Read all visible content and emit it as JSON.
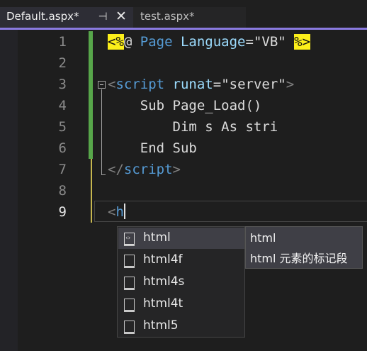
{
  "tabs": [
    {
      "title": "Default.aspx*",
      "active": true
    },
    {
      "title": "test.aspx*",
      "active": false
    }
  ],
  "tab_icons": {
    "pin": "pin-icon",
    "close": "close-icon"
  },
  "editor": {
    "lines": [
      {
        "number": "1",
        "tokens": [
          {
            "t": "<%",
            "c": "hl-yellow"
          },
          {
            "t": "@ ",
            "c": "c-text"
          },
          {
            "t": "Page ",
            "c": "c-blue"
          },
          {
            "t": "Language",
            "c": "c-attr"
          },
          {
            "t": "=",
            "c": "c-text"
          },
          {
            "t": "\"VB\"",
            "c": "c-text"
          },
          {
            "t": " ",
            "c": "c-text"
          },
          {
            "t": "%>",
            "c": "hl-yellow"
          }
        ]
      },
      {
        "number": "2",
        "tokens": []
      },
      {
        "number": "3",
        "tokens": [
          {
            "t": "<",
            "c": "c-punct"
          },
          {
            "t": "script",
            "c": "c-tag"
          },
          {
            "t": " ",
            "c": "c-text"
          },
          {
            "t": "runat",
            "c": "c-attr"
          },
          {
            "t": "=",
            "c": "c-text"
          },
          {
            "t": "\"server\"",
            "c": "c-text"
          },
          {
            "t": ">",
            "c": "c-punct"
          }
        ]
      },
      {
        "number": "4",
        "tokens": [
          {
            "t": "    Sub Page_Load()",
            "c": "c-text"
          }
        ]
      },
      {
        "number": "5",
        "tokens": [
          {
            "t": "        Dim s As stri",
            "c": "c-text"
          }
        ]
      },
      {
        "number": "6",
        "tokens": [
          {
            "t": "    End Sub",
            "c": "c-text"
          }
        ]
      },
      {
        "number": "7",
        "tokens": [
          {
            "t": "</",
            "c": "c-punct"
          },
          {
            "t": "script",
            "c": "c-tag"
          },
          {
            "t": ">",
            "c": "c-punct"
          }
        ]
      },
      {
        "number": "8",
        "tokens": []
      },
      {
        "number": "9",
        "tokens": [
          {
            "t": "<",
            "c": "c-punct"
          },
          {
            "t": "h",
            "c": "c-tag"
          }
        ]
      }
    ],
    "current_line": "9"
  },
  "completion": {
    "items": [
      "html",
      "html4f",
      "html4s",
      "html4t",
      "html5"
    ],
    "selected_index": 0,
    "tooltip": {
      "title": "html",
      "description": "html 元素的标记段"
    }
  },
  "colors": {
    "accent": "#8a7ae0",
    "saved_change": "#57a64a",
    "unsaved_change": "#c7b74f",
    "tag_highlight": "#fcef1a"
  }
}
